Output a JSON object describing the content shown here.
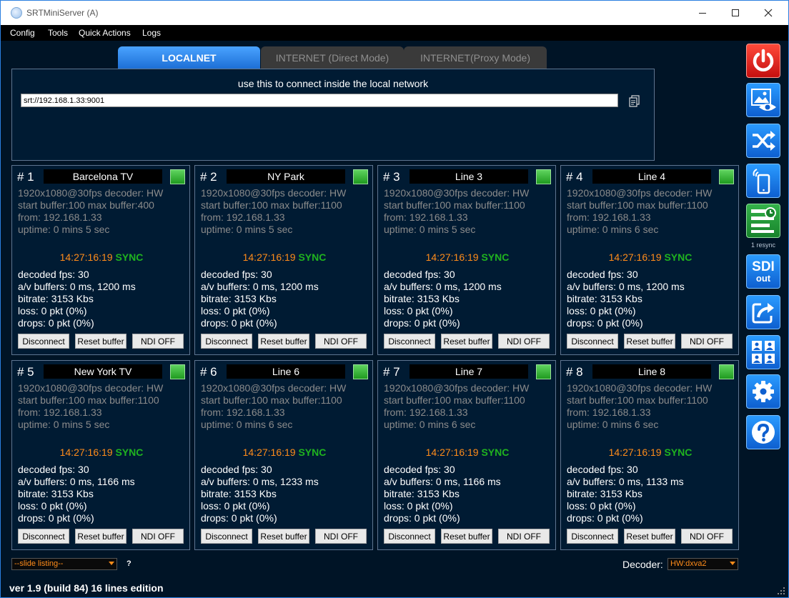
{
  "window": {
    "title": "SRTMiniServer (A)"
  },
  "menu": [
    "Config",
    "Tools",
    "Quick Actions",
    "Logs"
  ],
  "tabs": [
    "LOCALNET",
    "INTERNET (Direct Mode)",
    "INTERNET(Proxy Mode)"
  ],
  "localnet": {
    "hint": "use this to connect inside the local network",
    "url": "srt://192.168.1.33:9001"
  },
  "lines": [
    {
      "num": "# 1",
      "name": "Barcelona TV",
      "format": "1920x1080@30fps  decoder: HW",
      "buffer": "start buffer:100  max buffer:400",
      "from": "from: 192.168.1.33",
      "uptime": "uptime:  0 mins 5 sec",
      "time": "14:27:16:19",
      "sync": "SYNC",
      "fps": "decoded fps: 30",
      "av": "a/v buffers: 0 ms, 1200 ms",
      "bitrate": "bitrate: 3153 Kbs",
      "loss": "loss: 0 pkt (0%)",
      "drops": "drops: 0 pkt (0%)"
    },
    {
      "num": "# 2",
      "name": "NY Park",
      "format": "1920x1080@30fps  decoder: HW",
      "buffer": "start buffer:100  max buffer:1100",
      "from": "from: 192.168.1.33",
      "uptime": "uptime:  0 mins 5 sec",
      "time": "14:27:16:19",
      "sync": "SYNC",
      "fps": "decoded fps: 30",
      "av": "a/v buffers: 0 ms, 1200 ms",
      "bitrate": "bitrate: 3153 Kbs",
      "loss": "loss: 0 pkt (0%)",
      "drops": "drops: 0 pkt (0%)"
    },
    {
      "num": "# 3",
      "name": "Line 3",
      "format": "1920x1080@30fps  decoder: HW",
      "buffer": "start buffer:100  max buffer:1100",
      "from": "from: 192.168.1.33",
      "uptime": "uptime:  0 mins 5 sec",
      "time": "14:27:16:19",
      "sync": "SYNC",
      "fps": "decoded fps: 30",
      "av": "a/v buffers: 0 ms, 1200 ms",
      "bitrate": "bitrate: 3153 Kbs",
      "loss": "loss: 0 pkt (0%)",
      "drops": "drops: 0 pkt (0%)"
    },
    {
      "num": "# 4",
      "name": "Line 4",
      "format": "1920x1080@30fps  decoder: HW",
      "buffer": "start buffer:100  max buffer:1100",
      "from": "from: 192.168.1.33",
      "uptime": "uptime:  0 mins 6 sec",
      "time": "14:27:16:19",
      "sync": "SYNC",
      "fps": "decoded fps: 30",
      "av": "a/v buffers: 0 ms, 1200 ms",
      "bitrate": "bitrate: 3153 Kbs",
      "loss": "loss: 0 pkt (0%)",
      "drops": "drops: 0 pkt (0%)"
    },
    {
      "num": "# 5",
      "name": "New York TV",
      "format": "1920x1080@30fps  decoder: HW",
      "buffer": "start buffer:100  max buffer:1100",
      "from": "from: 192.168.1.33",
      "uptime": "uptime:  0 mins 5 sec",
      "time": "14:27:16:19",
      "sync": "SYNC",
      "fps": "decoded fps: 30",
      "av": "a/v buffers: 0 ms, 1166 ms",
      "bitrate": "bitrate: 3153 Kbs",
      "loss": "loss: 0 pkt (0%)",
      "drops": "drops: 0 pkt (0%)"
    },
    {
      "num": "# 6",
      "name": "Line 6",
      "format": "1920x1080@30fps  decoder: HW",
      "buffer": "start buffer:100  max buffer:1100",
      "from": "from: 192.168.1.33",
      "uptime": "uptime:  0 mins 6 sec",
      "time": "14:27:16:19",
      "sync": "SYNC",
      "fps": "decoded fps: 30",
      "av": "a/v buffers: 0 ms, 1233 ms",
      "bitrate": "bitrate: 3153 Kbs",
      "loss": "loss: 0 pkt (0%)",
      "drops": "drops: 0 pkt (0%)"
    },
    {
      "num": "# 7",
      "name": "Line 7",
      "format": "1920x1080@30fps  decoder: HW",
      "buffer": "start buffer:100  max buffer:1100",
      "from": "from: 192.168.1.33",
      "uptime": "uptime:  0 mins 6 sec",
      "time": "14:27:16:19",
      "sync": "SYNC",
      "fps": "decoded fps: 30",
      "av": "a/v buffers: 0 ms, 1166 ms",
      "bitrate": "bitrate: 3153 Kbs",
      "loss": "loss: 0 pkt (0%)",
      "drops": "drops: 0 pkt (0%)"
    },
    {
      "num": "# 8",
      "name": "Line 8",
      "format": "1920x1080@30fps  decoder: HW",
      "buffer": "start buffer:100  max buffer:1100",
      "from": "from: 192.168.1.33",
      "uptime": "uptime:  0 mins 6 sec",
      "time": "14:27:16:19",
      "sync": "SYNC",
      "fps": "decoded fps: 30",
      "av": "a/v buffers: 0 ms, 1133 ms",
      "bitrate": "bitrate: 3153 Kbs",
      "loss": "loss: 0 pkt (0%)",
      "drops": "drops: 0 pkt (0%)"
    }
  ],
  "line_buttons": {
    "disconnect": "Disconnect",
    "reset": "Reset buffer",
    "ndi": "NDI OFF"
  },
  "sidebar": {
    "icons": [
      "power-icon",
      "preview-icon",
      "shuffle-icon",
      "mobile-icon",
      "schedule-icon",
      "sdi-out-icon",
      "share-icon",
      "users-icon",
      "gear-icon",
      "help-icon"
    ],
    "resync_label": "1 resync",
    "sdi_label_top": "SDI",
    "sdi_label_bottom": "out"
  },
  "bottom": {
    "slide_select": "--slide listing--",
    "help": "?",
    "decoder_label": "Decoder:",
    "decoder_value": "HW:dxva2",
    "version": "ver 1.9 (build 84)   16 lines edition"
  },
  "colors": {
    "accent": "#1d6fd6",
    "background": "#001426",
    "panel": "#001b33",
    "sync": "#1fb31f",
    "timecode": "#ff8c1a",
    "power": "#d81b1b",
    "led": "#2fb52f"
  }
}
